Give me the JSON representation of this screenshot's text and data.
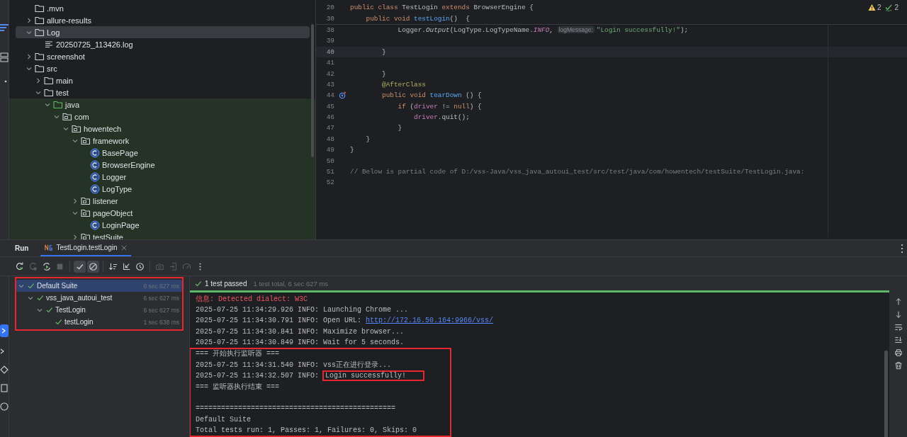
{
  "project_tree": {
    "items": [
      {
        "label": ".mvn",
        "kind": "folder",
        "selected": false
      },
      {
        "label": "allure-results",
        "kind": "folder",
        "expanded": false,
        "selected": false
      },
      {
        "label": "Log",
        "kind": "folder",
        "expanded": true,
        "selected": true,
        "children": [
          {
            "label": "20250725_113426.log",
            "kind": "file",
            "selected": false
          }
        ]
      },
      {
        "label": "screenshot",
        "kind": "folder",
        "expanded": false,
        "selected": false
      },
      {
        "label": "src",
        "kind": "folder",
        "expanded": true,
        "selected": false,
        "children": [
          {
            "label": "main",
            "kind": "folder",
            "expanded": false,
            "selected": false
          },
          {
            "label": "test",
            "kind": "folder",
            "expanded": true,
            "selected": false,
            "children": [
              {
                "label": "java",
                "kind": "source_root",
                "expanded": true,
                "selected": false,
                "children": [
                  {
                    "label": "com",
                    "kind": "package",
                    "expanded": true,
                    "selected": false,
                    "children": [
                      {
                        "label": "howentech",
                        "kind": "package",
                        "expanded": true,
                        "selected": false,
                        "children": [
                          {
                            "label": "framework",
                            "kind": "package",
                            "expanded": true,
                            "selected": false,
                            "children": [
                              {
                                "label": "BasePage",
                                "kind": "class",
                                "selected": false
                              },
                              {
                                "label": "BrowserEngine",
                                "kind": "class",
                                "selected": false
                              },
                              {
                                "label": "Logger",
                                "kind": "class",
                                "selected": false
                              },
                              {
                                "label": "LogType",
                                "kind": "class",
                                "selected": false
                              }
                            ]
                          },
                          {
                            "label": "listener",
                            "kind": "package",
                            "expanded": false,
                            "selected": false
                          },
                          {
                            "label": "pageObject",
                            "kind": "package",
                            "expanded": true,
                            "selected": false,
                            "children": [
                              {
                                "label": "LoginPage",
                                "kind": "class",
                                "selected": false
                              }
                            ]
                          },
                          {
                            "label": "testSuite",
                            "kind": "package",
                            "expanded": false,
                            "selected": false
                          }
                        ]
                      }
                    ]
                  }
                ]
              }
            ]
          }
        ]
      }
    ]
  },
  "editor": {
    "inspections": [
      {
        "kind": "warning",
        "count": "2"
      },
      {
        "kind": "typo",
        "count": "2"
      }
    ],
    "sticky_lines": [
      {
        "number": "20",
        "tokens": [
          {
            "text": "public class ",
            "kind": "keyword"
          },
          {
            "text": "TestLogin ",
            "kind": "plain"
          },
          {
            "text": "extends ",
            "kind": "keyword"
          },
          {
            "text": "BrowserEngine {",
            "kind": "plain"
          }
        ]
      },
      {
        "number": "30",
        "tokens": [
          {
            "text": "    public void ",
            "kind": "keyword"
          },
          {
            "text": "testLogin",
            "kind": "method"
          },
          {
            "text": "()  {",
            "kind": "plain"
          }
        ]
      }
    ],
    "lines": [
      {
        "number": "38",
        "current": false,
        "gutter_mark": false,
        "tokens": [
          {
            "text": "            Logger.",
            "kind": "plain"
          },
          {
            "text": "Output",
            "kind": "static_call"
          },
          {
            "text": "(LogType.LogTypeName.",
            "kind": "plain"
          },
          {
            "text": "INFO",
            "kind": "constant"
          },
          {
            "text": ", ",
            "kind": "plain"
          },
          {
            "text": "logMessage:",
            "kind": "hint"
          },
          {
            "text": "\"Login successfully!\"",
            "kind": "string"
          },
          {
            "text": ");",
            "kind": "plain"
          }
        ]
      },
      {
        "number": "39",
        "current": false,
        "gutter_mark": false
      },
      {
        "number": "40",
        "current": true,
        "gutter_mark": false,
        "tokens": [
          {
            "text": "        }",
            "kind": "plain"
          }
        ]
      },
      {
        "number": "41",
        "current": false,
        "gutter_mark": false
      },
      {
        "number": "42",
        "current": false,
        "gutter_mark": false,
        "tokens": [
          {
            "text": "        }",
            "kind": "plain"
          }
        ]
      },
      {
        "number": "43",
        "current": false,
        "gutter_mark": false,
        "tokens": [
          {
            "text": "        @AfterClass",
            "kind": "annotation"
          }
        ]
      },
      {
        "number": "44",
        "current": false,
        "gutter_mark": true,
        "tokens": [
          {
            "text": "        public void ",
            "kind": "keyword"
          },
          {
            "text": "tearDown",
            "kind": "method"
          },
          {
            "text": " () {",
            "kind": "plain"
          }
        ]
      },
      {
        "number": "45",
        "current": false,
        "gutter_mark": false,
        "tokens": [
          {
            "text": "            if ",
            "kind": "keyword"
          },
          {
            "text": "(",
            "kind": "plain"
          },
          {
            "text": "driver",
            "kind": "field"
          },
          {
            "text": " != ",
            "kind": "plain"
          },
          {
            "text": "null",
            "kind": "keyword"
          },
          {
            "text": ") {",
            "kind": "plain"
          }
        ]
      },
      {
        "number": "46",
        "current": false,
        "gutter_mark": false,
        "tokens": [
          {
            "text": "                driver",
            "kind": "field"
          },
          {
            "text": ".quit();",
            "kind": "plain"
          }
        ]
      },
      {
        "number": "47",
        "current": false,
        "gutter_mark": false,
        "tokens": [
          {
            "text": "            }",
            "kind": "plain"
          }
        ]
      },
      {
        "number": "48",
        "current": false,
        "gutter_mark": false,
        "tokens": [
          {
            "text": "    }",
            "kind": "plain"
          }
        ]
      },
      {
        "number": "49",
        "current": false,
        "gutter_mark": false,
        "tokens": [
          {
            "text": "}",
            "kind": "plain"
          }
        ]
      },
      {
        "number": "50",
        "current": false,
        "gutter_mark": false
      },
      {
        "number": "51",
        "current": false,
        "gutter_mark": false,
        "tokens": [
          {
            "text": "// Below is partial code of D:/vss-Java/vss_java_autoui_test/src/test/java/com/howentech/testSuite/TestLogin.java:",
            "kind": "comment"
          }
        ]
      },
      {
        "number": "52",
        "current": false,
        "gutter_mark": false
      }
    ]
  },
  "run_panel": {
    "title": "Run",
    "tabs": [
      {
        "label": "TestLogin.testLogin",
        "selected": true
      }
    ],
    "toolbar_groups": [
      {
        "buttons": [
          {
            "kind": "rerun",
            "disabled": false,
            "on": false
          },
          {
            "kind": "rerun_failed",
            "disabled": true,
            "on": false
          },
          {
            "kind": "toggle_auto",
            "disabled": false,
            "on": false
          },
          {
            "kind": "stop",
            "disabled": true,
            "on": false
          }
        ]
      },
      {
        "buttons": [
          {
            "kind": "show_passed",
            "disabled": false,
            "on": true
          },
          {
            "kind": "show_ignored",
            "disabled": false,
            "on": true
          }
        ]
      },
      {
        "buttons": [
          {
            "kind": "sort",
            "disabled": false,
            "on": false
          },
          {
            "kind": "collapse",
            "disabled": false,
            "on": false
          },
          {
            "kind": "history",
            "disabled": false,
            "on": false
          }
        ]
      },
      {
        "buttons": [
          {
            "kind": "screenshot",
            "disabled": true,
            "on": false
          },
          {
            "kind": "import",
            "disabled": true,
            "on": false
          },
          {
            "kind": "gauge",
            "disabled": true,
            "on": false
          },
          {
            "kind": "more",
            "disabled": false,
            "on": false
          }
        ]
      }
    ],
    "test_tree": {
      "outlined": true,
      "items": [
        {
          "name": "Default Suite",
          "duration": "6 sec 627 ms",
          "passed": true,
          "expanded": true,
          "selected": true,
          "children": [
            {
              "name": "vss_java_autoui_test",
              "duration": "6 sec 627 ms",
              "passed": true,
              "expanded": true,
              "selected": false,
              "children": [
                {
                  "name": "TestLogin",
                  "duration": "6 sec 627 ms",
                  "passed": true,
                  "expanded": true,
                  "selected": false,
                  "children": [
                    {
                      "name": "testLogin",
                      "duration": "1 sec 638 ms",
                      "passed": true,
                      "selected": false
                    }
                  ]
                }
              ]
            }
          ]
        }
      ]
    },
    "status": {
      "summary": "1 test passed",
      "detail": "1 test total, 6 sec 627 ms",
      "passed": true,
      "level": 1
    },
    "console": {
      "blocks": [
        {
          "outlined": false,
          "lines": [
            {
              "kind": "text",
              "segments": [
                {
                  "text": "信息: Detected dialect: W3C",
                  "kind": "error",
                  "outlined": false
                }
              ]
            },
            {
              "kind": "text",
              "segments": [
                {
                  "text": "2025-07-25 11:34:29.926 INFO: Launching Chrome ...",
                  "kind": "plain",
                  "outlined": false
                }
              ]
            },
            {
              "kind": "text",
              "segments": [
                {
                  "text": "2025-07-25 11:34:30.791 INFO: Open URL: ",
                  "kind": "plain",
                  "outlined": false
                },
                {
                  "text": "http://172.16.50.164:9966/vss/",
                  "kind": "link",
                  "outlined": false
                }
              ]
            },
            {
              "kind": "text",
              "segments": [
                {
                  "text": "2025-07-25 11:34:30.841 INFO: Maximize browser...",
                  "kind": "plain",
                  "outlined": false
                }
              ]
            },
            {
              "kind": "text",
              "segments": [
                {
                  "text": "2025-07-25 11:34:30.849 INFO: Wait for 5 seconds.",
                  "kind": "plain",
                  "outlined": false
                }
              ]
            }
          ]
        },
        {
          "outlined": true,
          "lines": [
            {
              "kind": "text",
              "segments": [
                {
                  "text": "=== 开始执行监听器 ===",
                  "kind": "plain",
                  "outlined": false
                }
              ]
            },
            {
              "kind": "text",
              "segments": [
                {
                  "text": "2025-07-25 11:34:31.540 INFO: vss正在进行登录...",
                  "kind": "plain",
                  "outlined": false
                }
              ]
            },
            {
              "kind": "text",
              "segments": [
                {
                  "text": "2025-07-25 11:34:32.507 INFO: ",
                  "kind": "plain",
                  "outlined": false
                },
                {
                  "text": "Login successfully!",
                  "kind": "plain",
                  "outlined": true
                }
              ]
            },
            {
              "kind": "text",
              "segments": [
                {
                  "text": "=== 监听器执行结束 ===",
                  "kind": "plain",
                  "outlined": false
                }
              ]
            },
            {
              "kind": "blank"
            },
            {
              "kind": "text",
              "segments": [
                {
                  "text": "===============================================",
                  "kind": "plain",
                  "outlined": false
                }
              ]
            },
            {
              "kind": "text",
              "segments": [
                {
                  "text": "Default Suite",
                  "kind": "plain",
                  "outlined": false
                }
              ]
            },
            {
              "kind": "text",
              "segments": [
                {
                  "text": "Total tests run: 1, Passes: 1, Failures: 0, Skips: 0",
                  "kind": "plain",
                  "outlined": false
                }
              ]
            }
          ]
        }
      ]
    },
    "console_actions": [
      {
        "kind": "up"
      },
      {
        "kind": "down"
      },
      {
        "kind": "wrap"
      },
      {
        "kind": "scroll_end"
      },
      {
        "kind": "print"
      },
      {
        "kind": "clear"
      }
    ]
  }
}
